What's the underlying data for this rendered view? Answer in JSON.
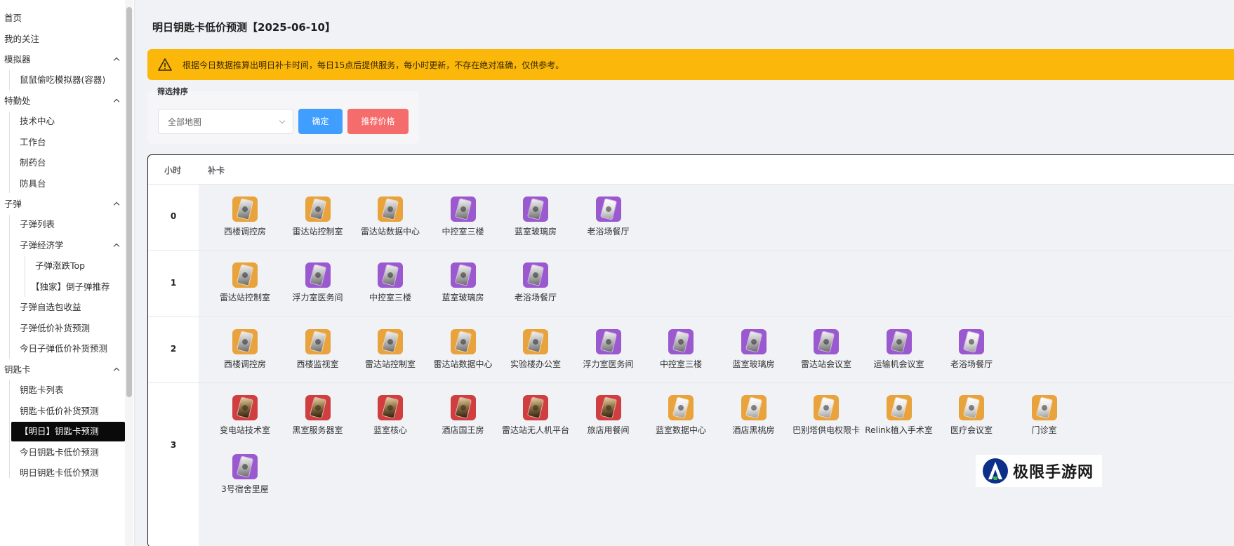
{
  "sidebar": {
    "items": [
      {
        "label": "首页",
        "level": 0
      },
      {
        "label": "我的关注",
        "level": 0
      },
      {
        "label": "模拟器",
        "level": 0,
        "expandable": true
      },
      {
        "label": "鼠鼠偷吃模拟器(容器)",
        "level": 1
      },
      {
        "label": "特勤处",
        "level": 0,
        "expandable": true
      },
      {
        "label": "技术中心",
        "level": 1
      },
      {
        "label": "工作台",
        "level": 1
      },
      {
        "label": "制药台",
        "level": 1
      },
      {
        "label": "防具台",
        "level": 1
      },
      {
        "label": "子弹",
        "level": 0,
        "expandable": true
      },
      {
        "label": "子弹列表",
        "level": 1
      },
      {
        "label": "子弹经济学",
        "level": 1,
        "expandable": true
      },
      {
        "label": "子弹涨跌Top",
        "level": 2
      },
      {
        "label": "【独家】倒子弹推荐",
        "level": 2
      },
      {
        "label": "子弹自选包收益",
        "level": 1
      },
      {
        "label": "子弹低价补货预测",
        "level": 1
      },
      {
        "label": "今日子弹低价补货预测",
        "level": 1
      },
      {
        "label": "钥匙卡",
        "level": 0,
        "expandable": true
      },
      {
        "label": "钥匙卡列表",
        "level": 1
      },
      {
        "label": "钥匙卡低价补货预测",
        "level": 1
      },
      {
        "label": "【明日】钥匙卡预测",
        "level": 1,
        "active": true
      },
      {
        "label": "今日钥匙卡低价预测",
        "level": 1
      },
      {
        "label": "明日钥匙卡低价预测",
        "level": 1
      }
    ]
  },
  "header": {
    "title": "明日钥匙卡低价预测【2025-06-10】"
  },
  "alert": {
    "text": "根据今日数据推算出明日补卡时间，每日15点后提供服务，每小时更新，不存在绝对准确，仅供参考。",
    "color": "#fbb70a"
  },
  "filter": {
    "title": "筛选排序",
    "select_value": "全部地图",
    "confirm_label": "确定",
    "recommend_label": "推荐价格"
  },
  "table": {
    "headers": {
      "hour": "小时",
      "card": "补卡"
    },
    "rows": [
      {
        "hour": "0",
        "cards": [
          {
            "name": "西楼调控房",
            "tier": "gold"
          },
          {
            "name": "雷达站控制室",
            "tier": "gold"
          },
          {
            "name": "雷达站数据中心",
            "tier": "gold"
          },
          {
            "name": "中控室三楼",
            "tier": "purple"
          },
          {
            "name": "蓝室玻璃房",
            "tier": "purple"
          },
          {
            "name": "老浴场餐厅",
            "tier": "purple"
          }
        ]
      },
      {
        "hour": "1",
        "cards": [
          {
            "name": "雷达站控制室",
            "tier": "gold"
          },
          {
            "name": "浮力室医务间",
            "tier": "purple"
          },
          {
            "name": "中控室三楼",
            "tier": "purple"
          },
          {
            "name": "蓝室玻璃房",
            "tier": "purple"
          },
          {
            "name": "老浴场餐厅",
            "tier": "purple"
          }
        ]
      },
      {
        "hour": "2",
        "cards": [
          {
            "name": "西楼调控房",
            "tier": "gold"
          },
          {
            "name": "西楼监视室",
            "tier": "gold"
          },
          {
            "name": "雷达站控制室",
            "tier": "gold"
          },
          {
            "name": "雷达站数据中心",
            "tier": "gold"
          },
          {
            "name": "实验楼办公室",
            "tier": "gold"
          },
          {
            "name": "浮力室医务间",
            "tier": "purple"
          },
          {
            "name": "中控室三楼",
            "tier": "purple"
          },
          {
            "name": "蓝室玻璃房",
            "tier": "purple"
          },
          {
            "name": "雷达站会议室",
            "tier": "purple"
          },
          {
            "name": "运输机会议室",
            "tier": "purple"
          },
          {
            "name": "老浴场餐厅",
            "tier": "purple"
          }
        ]
      },
      {
        "hour": "3",
        "cards": [
          {
            "name": "变电站技术室",
            "tier": "red"
          },
          {
            "name": "黑室服务器室",
            "tier": "red"
          },
          {
            "name": "蓝室核心",
            "tier": "red"
          },
          {
            "name": "酒店国王房",
            "tier": "red"
          },
          {
            "name": "雷达站无人机平台",
            "tier": "red"
          },
          {
            "name": "旅店用餐间",
            "tier": "red"
          },
          {
            "name": "蓝室数据中心",
            "tier": "gold"
          },
          {
            "name": "酒店黑桃房",
            "tier": "gold"
          },
          {
            "name": "巴别塔供电权限卡",
            "tier": "gold"
          },
          {
            "name": "Relink植入手术室",
            "tier": "gold"
          },
          {
            "name": "医疗会议室",
            "tier": "gold"
          },
          {
            "name": "门诊室",
            "tier": "gold"
          },
          {
            "name": "3号宿舍里屋",
            "tier": "purple"
          }
        ]
      }
    ]
  },
  "watermark": {
    "text": "极限手游网"
  },
  "colors": {
    "gold": "#e8a33d",
    "purple": "#9b59d0",
    "red": "#cf3f3f",
    "primary": "#409eff",
    "danger": "#f56c6c"
  }
}
